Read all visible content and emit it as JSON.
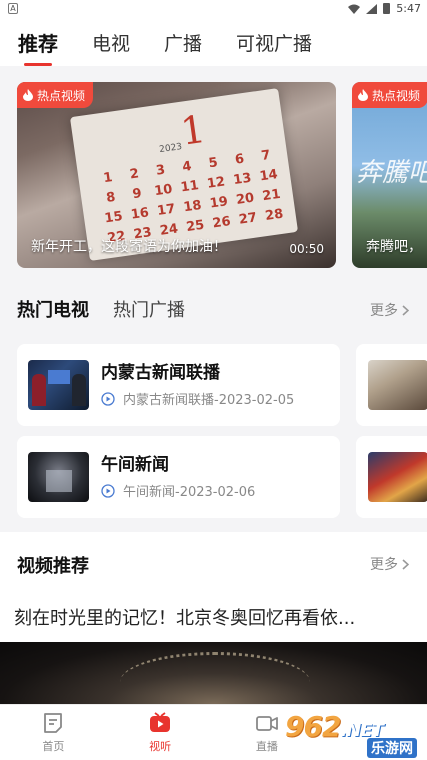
{
  "status_bar": {
    "time": "5:47",
    "app_icon_letter": "A"
  },
  "top_tabs": [
    {
      "label": "推荐",
      "active": true
    },
    {
      "label": "电视",
      "active": false
    },
    {
      "label": "广播",
      "active": false
    },
    {
      "label": "可视广播",
      "active": false
    }
  ],
  "banners": [
    {
      "badge": "热点视频",
      "caption": "新年开工，这段寄语为你加油！",
      "duration": "00:50",
      "calendar_number": "1",
      "calendar_year": "2023"
    },
    {
      "badge": "热点视频",
      "caption": "奔腾吧，",
      "overlay_text": "奔騰吧"
    }
  ],
  "hot_section": {
    "tabs": [
      {
        "label": "热门电视",
        "active": true
      },
      {
        "label": "热门广播",
        "active": false
      }
    ],
    "more_label": "更多",
    "items": [
      {
        "title": "内蒙古新闻联播",
        "meta": "内蒙古新闻联播-2023-02-05"
      },
      {
        "title": "午间新闻",
        "meta": "午间新闻-2023-02-06"
      }
    ]
  },
  "video_section": {
    "title": "视频推荐",
    "more_label": "更多",
    "headline": "刻在时光里的记忆！北京冬奥回忆再看依..."
  },
  "bottom_nav": [
    {
      "label": "首页",
      "icon": "home-doc-icon",
      "active": false
    },
    {
      "label": "视听",
      "icon": "play-video-icon",
      "active": true
    },
    {
      "label": "直播",
      "icon": "camera-icon",
      "active": false
    }
  ],
  "watermark": {
    "big": "962",
    "suffix": ".NET",
    "small": "乐游网"
  },
  "colors": {
    "accent": "#e8342e",
    "badge": "#f04a3c",
    "background": "#f4f4f6",
    "meta_text": "#888888"
  }
}
